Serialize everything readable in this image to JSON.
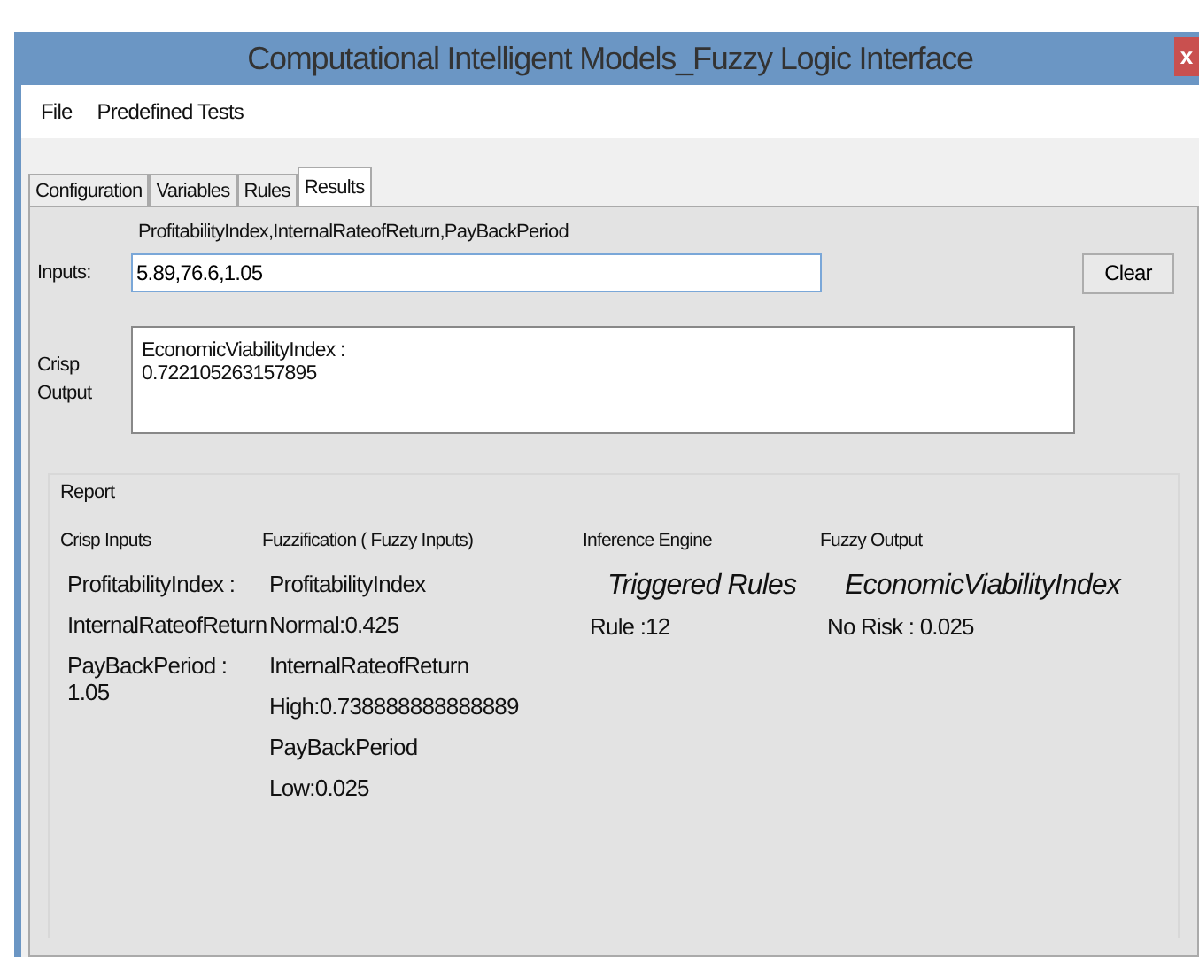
{
  "window": {
    "title": "Computational Intelligent Models_Fuzzy Logic Interface",
    "close": "x"
  },
  "menu": [
    "File",
    "Predefined Tests"
  ],
  "tabs": [
    {
      "label": "Configuration",
      "selected": false
    },
    {
      "label": "Variables",
      "selected": false
    },
    {
      "label": "Rules",
      "selected": false
    },
    {
      "label": "Results",
      "selected": true
    }
  ],
  "inputs": {
    "label": "Inputs:",
    "hint": "ProfitabilityIndex,InternalRateofReturn,PayBackPeriod",
    "value": "5.89,76.6,1.05",
    "button": "Clear"
  },
  "crisp_output": {
    "label": "Crisp Output",
    "lines": [
      "EconomicViabilityIndex :",
      "0.722105263157895"
    ]
  },
  "report": {
    "title": "Report",
    "columns": [
      {
        "heading": "Crisp Inputs",
        "items": [
          {
            "text": "ProfitabilityIndex :",
            "kind": "plain"
          },
          {
            "text": "InternalRateofReturn",
            "kind": "plain"
          },
          {
            "text": "PayBackPeriod :\n1.05",
            "kind": "plain"
          }
        ]
      },
      {
        "heading": "Fuzzification ( Fuzzy Inputs)",
        "items": [
          {
            "text": "ProfitabilityIndex",
            "kind": "plain"
          },
          {
            "text": "Normal:0.425",
            "kind": "plain"
          },
          {
            "text": "InternalRateofReturn",
            "kind": "plain"
          },
          {
            "text": "High:0.738888888888889",
            "kind": "plain"
          },
          {
            "text": "PayBackPeriod",
            "kind": "plain"
          },
          {
            "text": "Low:0.025",
            "kind": "plain"
          }
        ]
      },
      {
        "heading": "Inference Engine",
        "items": [
          {
            "text": "Triggered Rules",
            "kind": "title"
          },
          {
            "text": "Rule :12",
            "kind": "plain"
          }
        ]
      },
      {
        "heading": "Fuzzy Output",
        "items": [
          {
            "text": "EconomicViabilityIndex",
            "kind": "title"
          },
          {
            "text": "No Risk : 0.025",
            "kind": "plain"
          }
        ]
      }
    ]
  }
}
